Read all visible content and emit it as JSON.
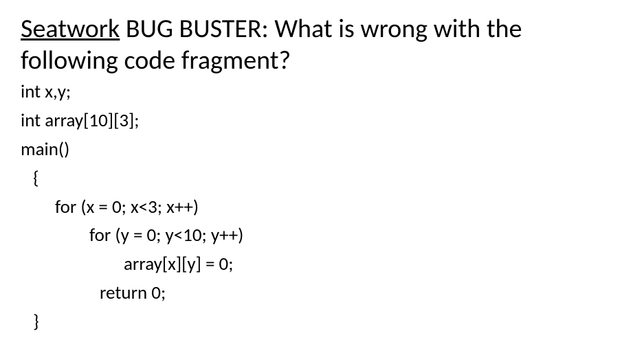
{
  "heading": {
    "underlined": "Seatwork",
    "rest": " BUG BUSTER: What is wrong with the following code fragment?"
  },
  "code": {
    "line1": "int x,y;",
    "line2": "int array[10][3];",
    "line3": "main()",
    "line4": " {",
    "line5": "for (x = 0; x<3; x++)",
    "line6": "for (y = 0; y<10; y++)",
    "line7": "array[x][y] = 0;",
    "line8": "return 0;",
    "line9": " }"
  }
}
